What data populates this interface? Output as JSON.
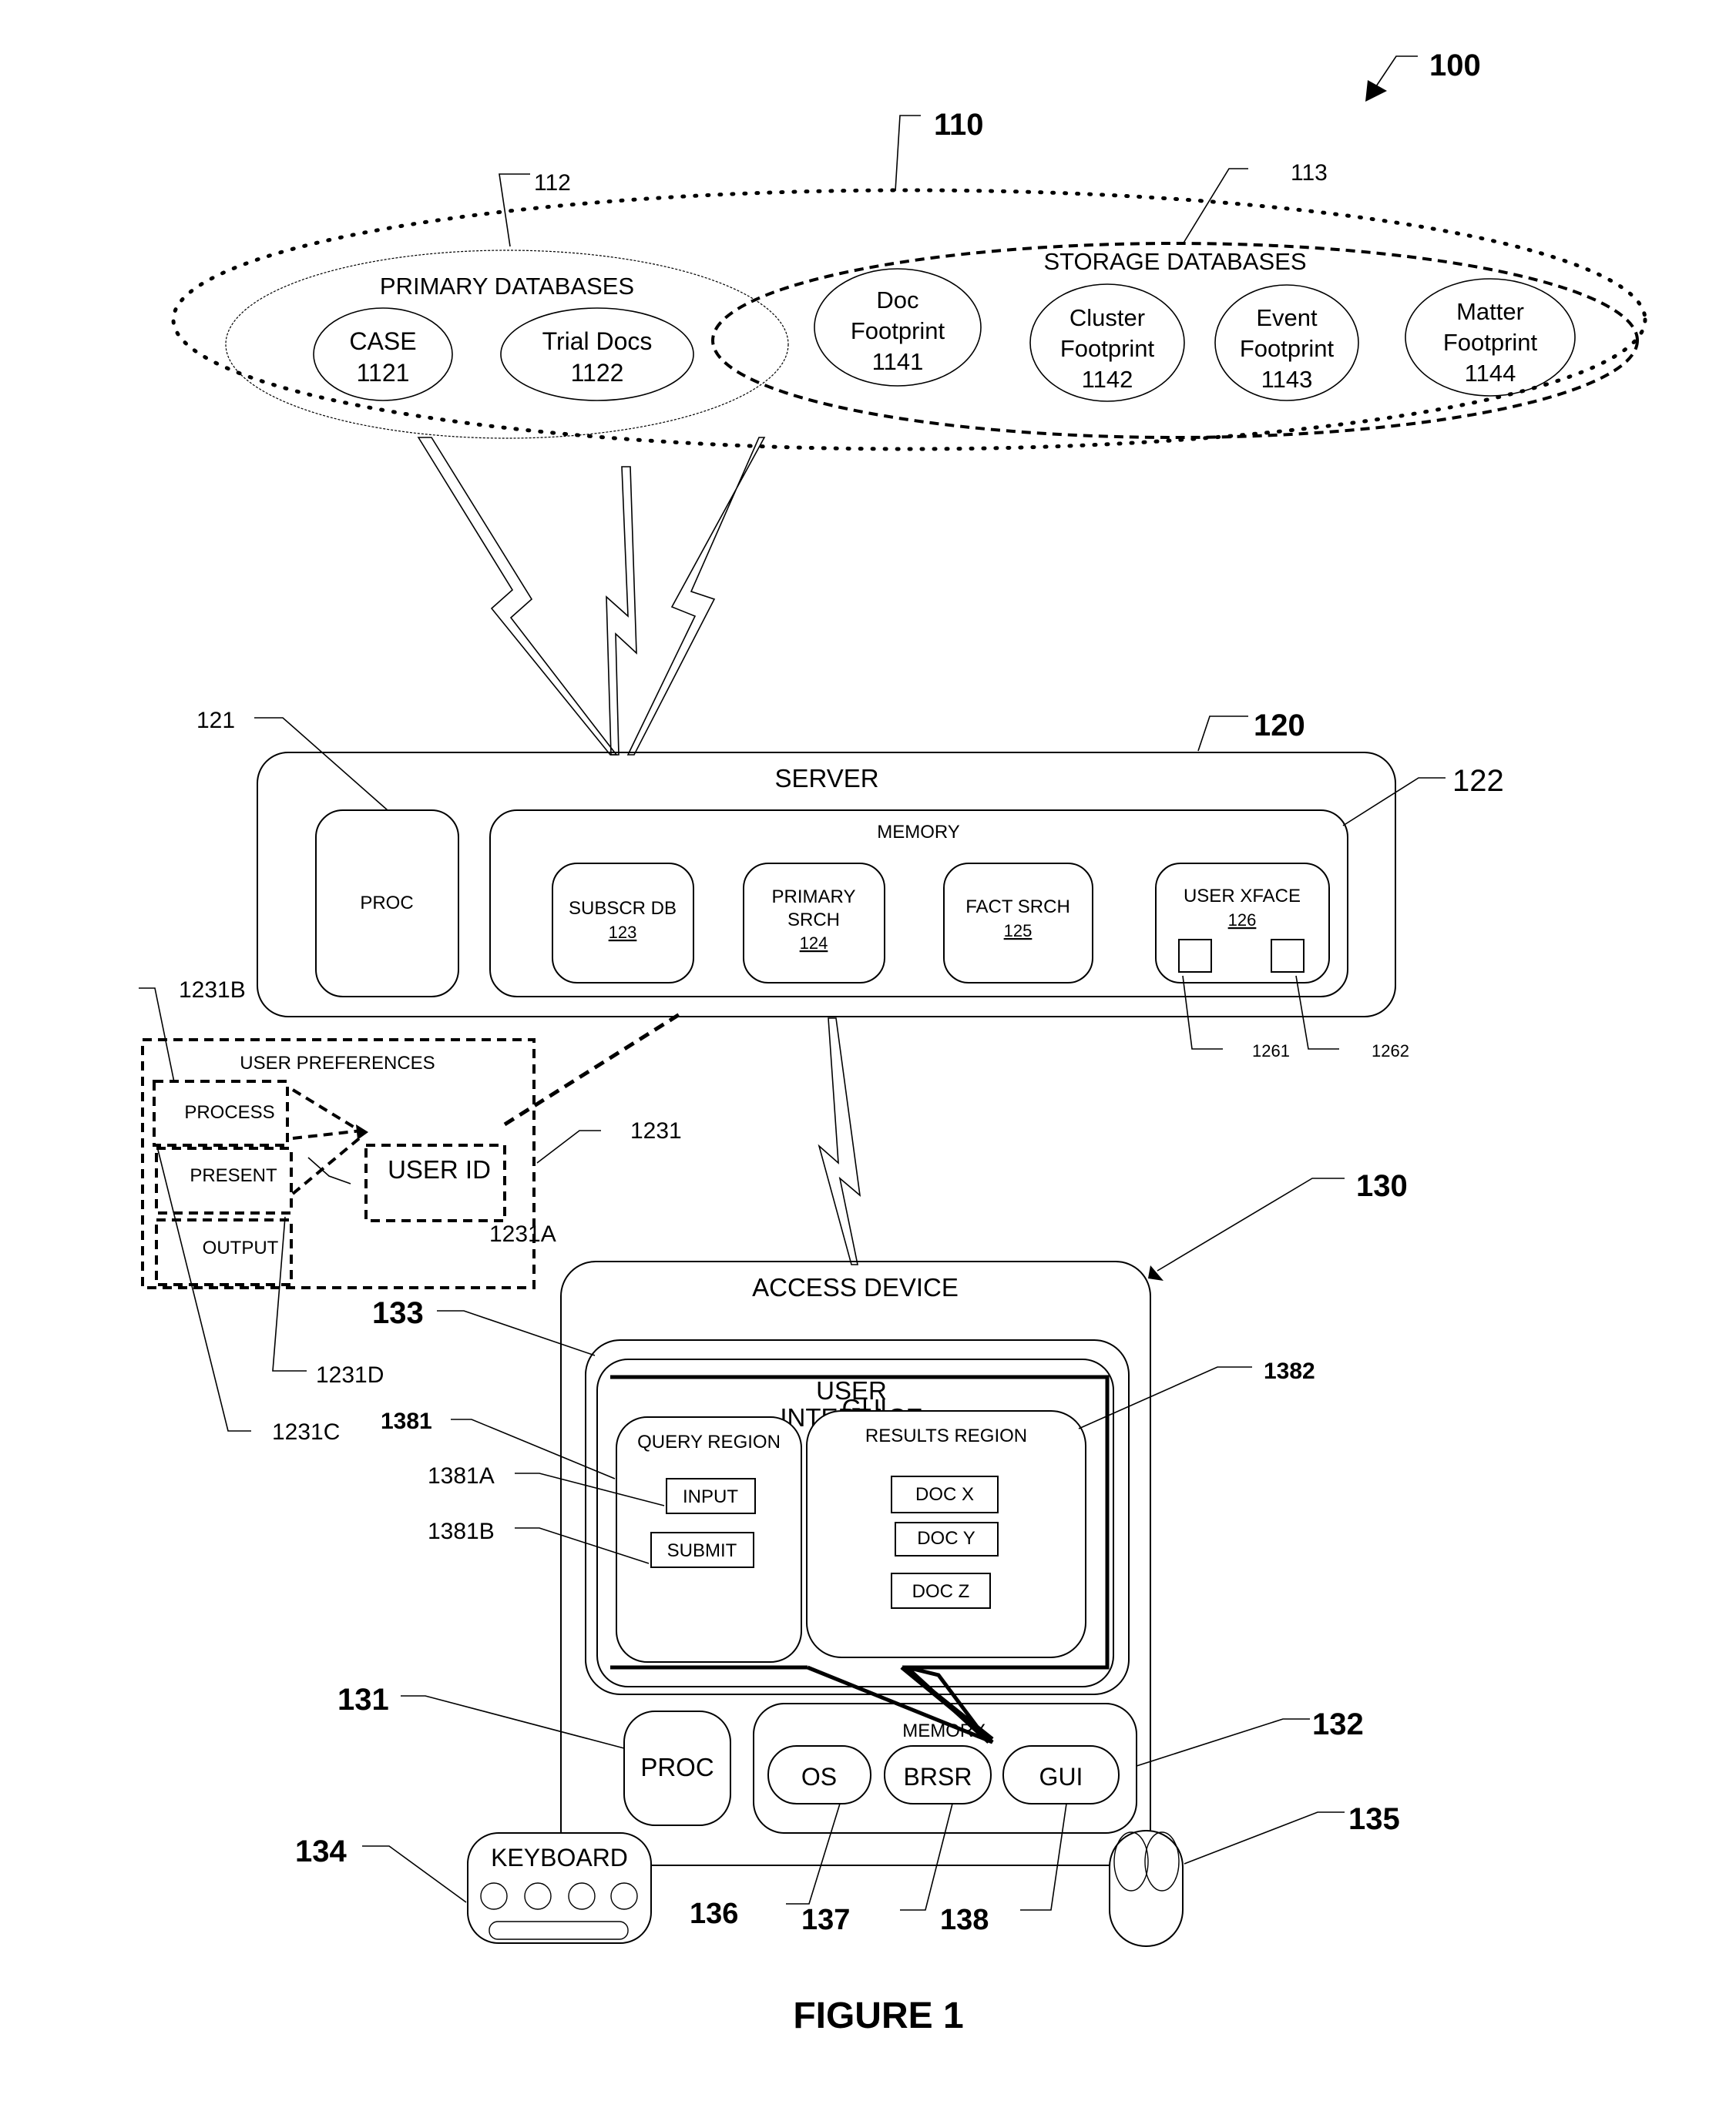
{
  "figure": {
    "caption": "FIGURE 1",
    "system_ref": "100"
  },
  "databases": {
    "ref": "110",
    "primary": {
      "ref": "112",
      "title": "PRIMARY DATABASES",
      "items": [
        {
          "name": "CASE",
          "ref": "1121"
        },
        {
          "name": "Trial Docs",
          "ref": "1122"
        }
      ]
    },
    "storage": {
      "ref": "113",
      "title": "STORAGE DATABASES",
      "items": [
        {
          "line1": "Doc",
          "line2": "Footprint",
          "ref": "1141"
        },
        {
          "line1": "Cluster",
          "line2": "Footprint",
          "ref": "1142"
        },
        {
          "line1": "Event",
          "line2": "Footprint",
          "ref": "1143"
        },
        {
          "line1": "Matter",
          "line2": "Footprint",
          "ref": "1144"
        }
      ]
    }
  },
  "server": {
    "ref": "120",
    "title": "SERVER",
    "proc": {
      "label": "PROC",
      "ref": "121"
    },
    "memory": {
      "label": "MEMORY",
      "ref": "122",
      "modules": [
        {
          "line1": "SUBSCR DB",
          "line2": "",
          "ref": "123"
        },
        {
          "line1": "PRIMARY",
          "line2": "SRCH",
          "ref": "124"
        },
        {
          "line1": "FACT SRCH",
          "line2": "",
          "ref": "125"
        },
        {
          "line1": "USER XFACE",
          "line2": "",
          "ref": "126"
        }
      ],
      "xface_subrefs": [
        "1261",
        "1262"
      ]
    }
  },
  "user_preferences": {
    "title": "USER PREFERENCES",
    "ref": "1231",
    "user_id": {
      "label": "USER ID",
      "ref": "1231A"
    },
    "items": [
      {
        "label": "PROCESS",
        "ref": "1231B"
      },
      {
        "label": "PRESENT",
        "ref": "1231C"
      },
      {
        "label": "OUTPUT",
        "ref": "1231D"
      }
    ]
  },
  "access_device": {
    "ref": "130",
    "title": "ACCESS DEVICE",
    "ui_ref": "133",
    "ui_label_line1": "USER",
    "ui_label_line2": "INTERFACE",
    "gui_overlay": "GUI",
    "query_region": {
      "label": "QUERY REGION",
      "ref": "1381",
      "input": {
        "label": "INPUT",
        "ref": "1381A"
      },
      "submit": {
        "label": "SUBMIT",
        "ref": "1381B"
      }
    },
    "results_region": {
      "label": "RESULTS REGION",
      "ref": "1382",
      "docs": [
        "DOC X",
        "DOC Y",
        "DOC Z"
      ]
    },
    "proc": {
      "label": "PROC",
      "ref": "131"
    },
    "memory": {
      "label": "MEMORY",
      "ref": "132",
      "items": [
        {
          "label": "OS",
          "ref": "136"
        },
        {
          "label": "BRSR",
          "ref": "137"
        },
        {
          "label": "GUI",
          "ref": "138"
        }
      ]
    },
    "keyboard": {
      "label": "KEYBOARD",
      "ref": "134"
    },
    "mouse": {
      "ref": "135"
    }
  }
}
